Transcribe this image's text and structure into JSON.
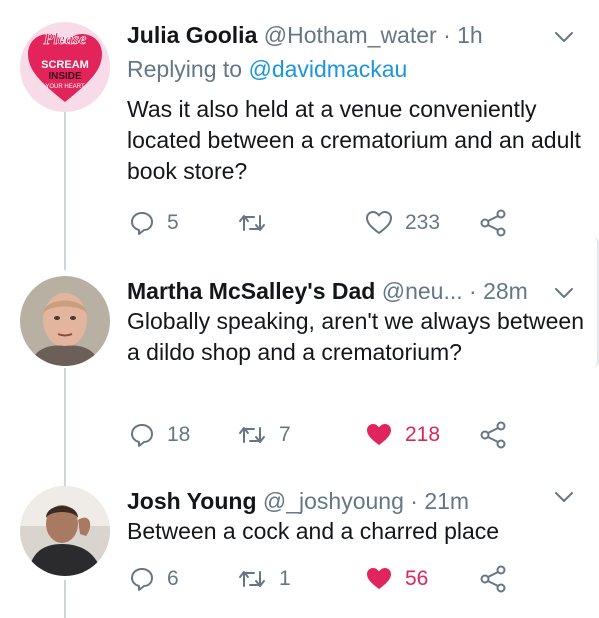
{
  "tweets": [
    {
      "name": "Julia Goolia",
      "handle": "@Hotham_water",
      "time": "1h",
      "reply_prefix": "Replying to",
      "reply_to": "@davidmackau",
      "body": "Was it also held at a venue conveniently located between a crematorium and an adult book store?",
      "replies": "5",
      "retweets": "",
      "likes": "233",
      "liked": false,
      "avatar_text": {
        "top": "Please",
        "mid": "SCREAM",
        "low": "INSIDE",
        "bottom": "YOUR HEART"
      }
    },
    {
      "name": "Martha McSalley's Dad",
      "handle": "@neu...",
      "time": "28m",
      "body": "Globally speaking, aren't we always between a dildo shop and a crematorium?",
      "replies": "18",
      "retweets": "7",
      "likes": "218",
      "liked": true
    },
    {
      "name": "Josh Young",
      "handle": "@_joshyoung",
      "time": "21m",
      "body": "Between a cock and a charred place",
      "replies": "6",
      "retweets": "1",
      "likes": "56",
      "liked": true
    }
  ],
  "colors": {
    "text": "#14171a",
    "muted": "#657786",
    "link": "#1b95e0",
    "like": "#e0245e",
    "thread": "#ccd6dd"
  },
  "icons": [
    "reply-icon",
    "retweet-icon",
    "like-icon",
    "share-icon",
    "chevron-down-icon"
  ]
}
